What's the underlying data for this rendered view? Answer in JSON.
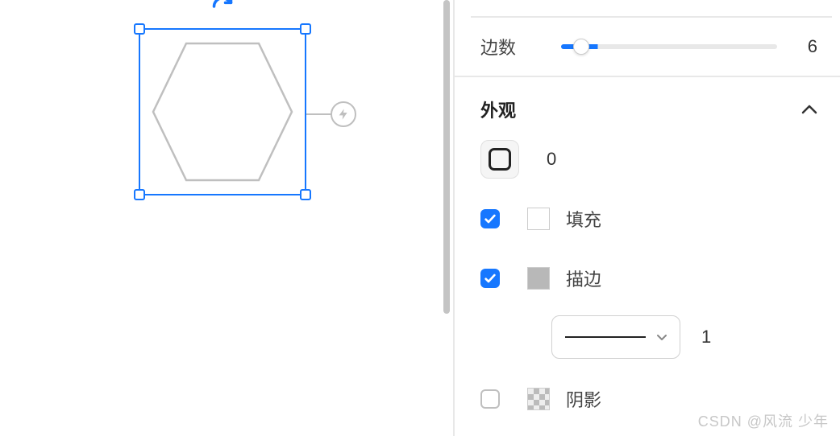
{
  "canvas": {
    "rotate_icon": "rotate-cw-icon",
    "node_icon": "lightning-icon",
    "shape": "hexagon"
  },
  "panel": {
    "sides": {
      "label": "边数",
      "value": "6",
      "min": "3",
      "max": "20"
    },
    "appearance": {
      "title": "外观",
      "corner_radius": "0",
      "fill": {
        "checked": true,
        "label": "填充",
        "color": "#ffffff"
      },
      "stroke": {
        "checked": true,
        "label": "描边",
        "color": "#b8b8b8",
        "width": "1",
        "style": "solid"
      },
      "shadow": {
        "checked": false,
        "label": "阴影"
      }
    }
  },
  "watermark": "CSDN @风流 少年"
}
